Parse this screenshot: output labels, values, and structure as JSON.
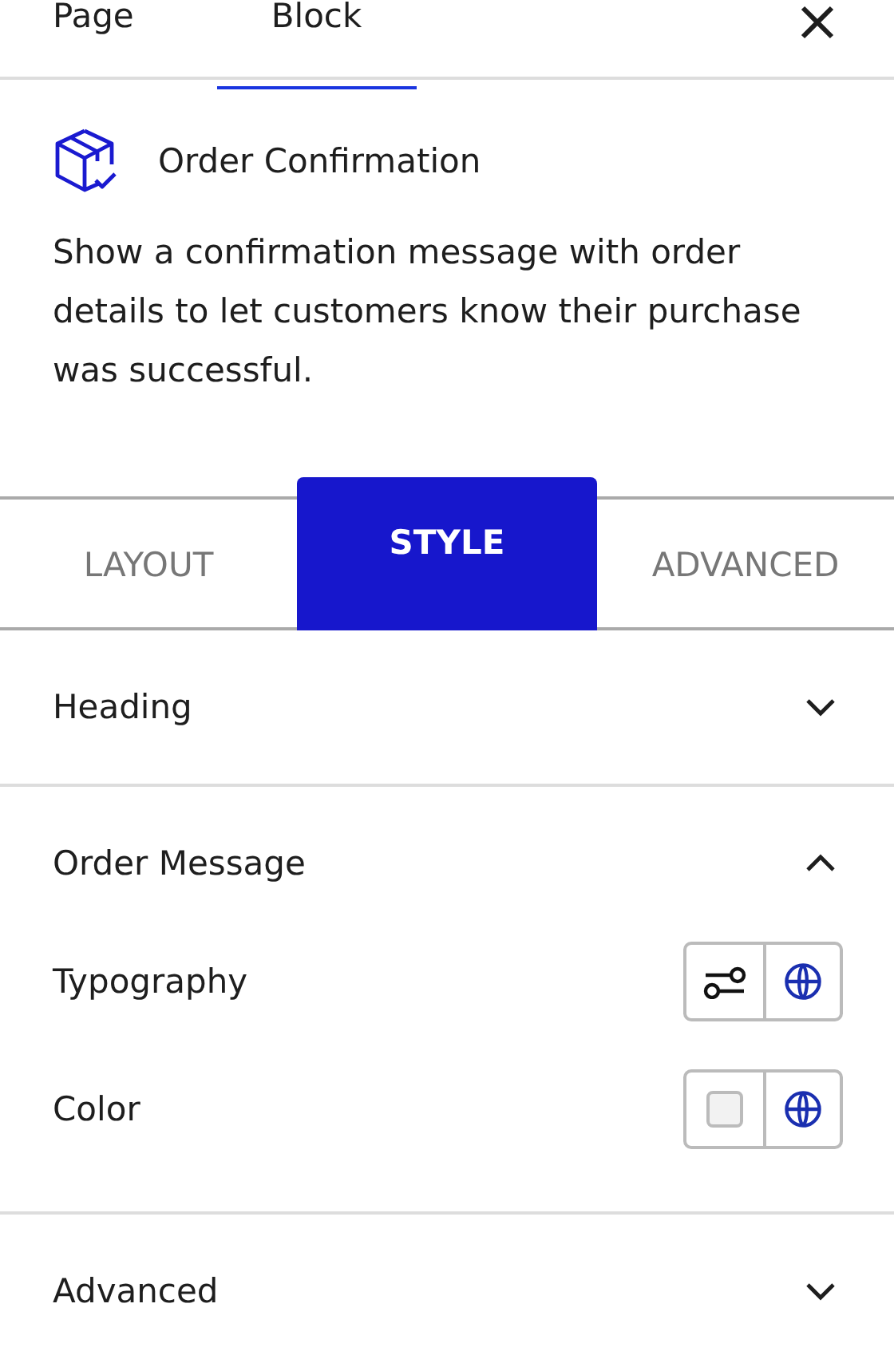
{
  "top_tabs": [
    {
      "label": "Page",
      "selected": false
    },
    {
      "label": "Block",
      "selected": true
    }
  ],
  "block": {
    "title": "Order Confirmation",
    "description": "Show a confirmation message with order details to let customers know their purchase was successful."
  },
  "style_tabs": [
    {
      "label": "LAYOUT",
      "selected": false
    },
    {
      "label": "STYLE",
      "selected": true
    },
    {
      "label": "ADVANCED",
      "selected": false
    }
  ],
  "sections": [
    {
      "title": "Heading",
      "expanded": false
    },
    {
      "title": "Order Message",
      "expanded": true,
      "settings": [
        {
          "label": "Typography",
          "kind": "typography"
        },
        {
          "label": "Color",
          "kind": "color"
        }
      ]
    },
    {
      "title": "Advanced",
      "expanded": false
    }
  ]
}
